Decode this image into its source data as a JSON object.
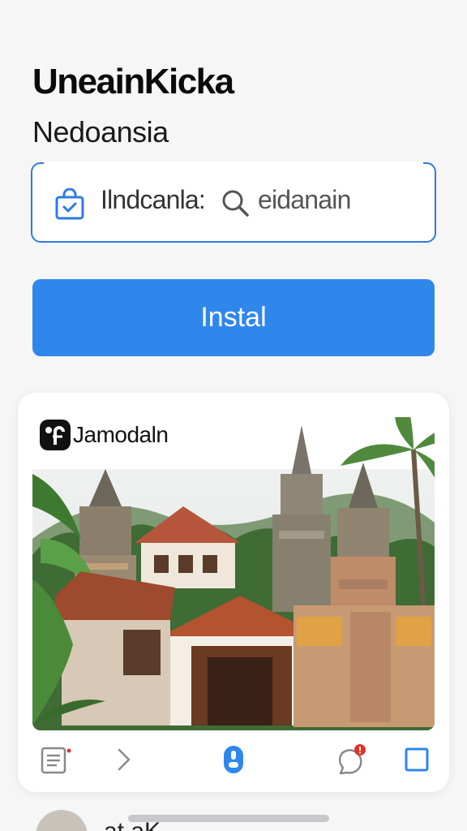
{
  "header": {
    "title": "UneainKicka",
    "subtitle": "Nedoansia"
  },
  "search": {
    "label": "Ilndcanla:",
    "value": "eidanain"
  },
  "install_button": {
    "label": "Instal"
  },
  "card": {
    "title": "Jamodaln",
    "photo_alt": "Balinese temple photo"
  },
  "next_item": {
    "text": "at aK"
  },
  "colors": {
    "accent": "#2f87eb",
    "border": "#2d7be0",
    "badge": "#e0342a"
  },
  "icons": {
    "search_prefix": "shopping-bag-icon",
    "search": "magnifier-icon",
    "toolbar": [
      "document-icon",
      "chevron-right-icon",
      "mouse-icon",
      "chat-notification-icon",
      "square-icon"
    ]
  }
}
